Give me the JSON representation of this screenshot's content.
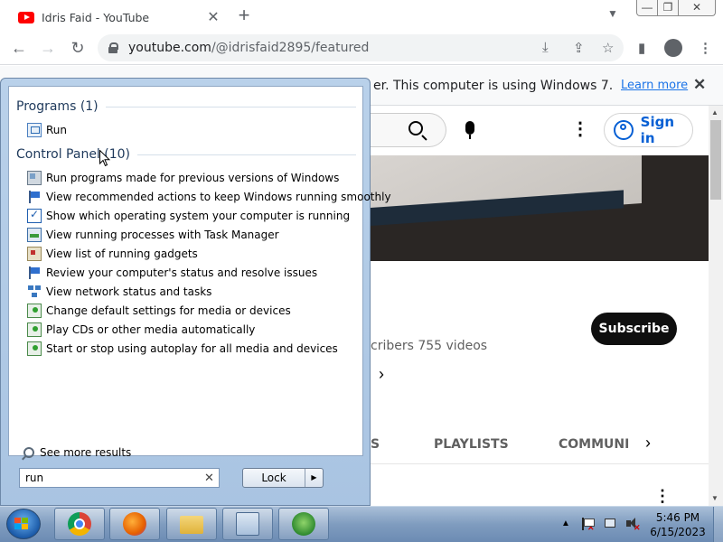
{
  "browser": {
    "tab_title": "Idris Faid - YouTube",
    "tab_close": "✕",
    "new_tab": "+",
    "url_host": "youtube.com",
    "url_path": "/@idrisfaid2895/featured",
    "back": "←",
    "forward": "→",
    "reload": "↻",
    "window_min": "—",
    "window_max": "❐",
    "window_close": "✕"
  },
  "infobar": {
    "text": "er. This computer is using Windows 7.",
    "learn_more": "Learn more",
    "close": "✕"
  },
  "youtube": {
    "sign_in": "Sign in",
    "subscribe": "Subscribe",
    "stats": "cribers   755 videos",
    "tabs": [
      "S",
      "PLAYLISTS",
      "COMMUNI"
    ],
    "chevron": "›"
  },
  "startmenu": {
    "groups": [
      {
        "title": "Programs (1)",
        "items": [
          {
            "label": "Run",
            "icon": "run-icon"
          }
        ]
      },
      {
        "title": "Control Panel (10)",
        "items": [
          {
            "label": "Run programs made for previous versions of Windows",
            "icon": "compat-icon"
          },
          {
            "label": "View recommended actions to keep Windows running smoothly",
            "icon": "flag-icon"
          },
          {
            "label": "Show which operating system your computer is running",
            "icon": "check-icon"
          },
          {
            "label": "View running processes with Task Manager",
            "icon": "task-manager-icon"
          },
          {
            "label": "View list of running gadgets",
            "icon": "gadget-icon"
          },
          {
            "label": "Review your computer's status and resolve issues",
            "icon": "flag-icon"
          },
          {
            "label": "View network status and tasks",
            "icon": "network-icon"
          },
          {
            "label": "Change default settings for media or devices",
            "icon": "media-icon"
          },
          {
            "label": "Play CDs or other media automatically",
            "icon": "media-icon"
          },
          {
            "label": "Start or stop using autoplay for all media and devices",
            "icon": "media-icon"
          }
        ]
      }
    ],
    "see_more": "See more results",
    "search_value": "run",
    "search_clear": "✕",
    "lock_label": "Lock",
    "lock_arrow": "▶"
  },
  "taskbar": {
    "items": [
      "chrome-icon",
      "firefox-icon",
      "explorer-icon",
      "control-panel-icon",
      "media-center-icon"
    ],
    "tray_arrow": "▲",
    "time": "5:46 PM",
    "date": "6/15/2023"
  }
}
